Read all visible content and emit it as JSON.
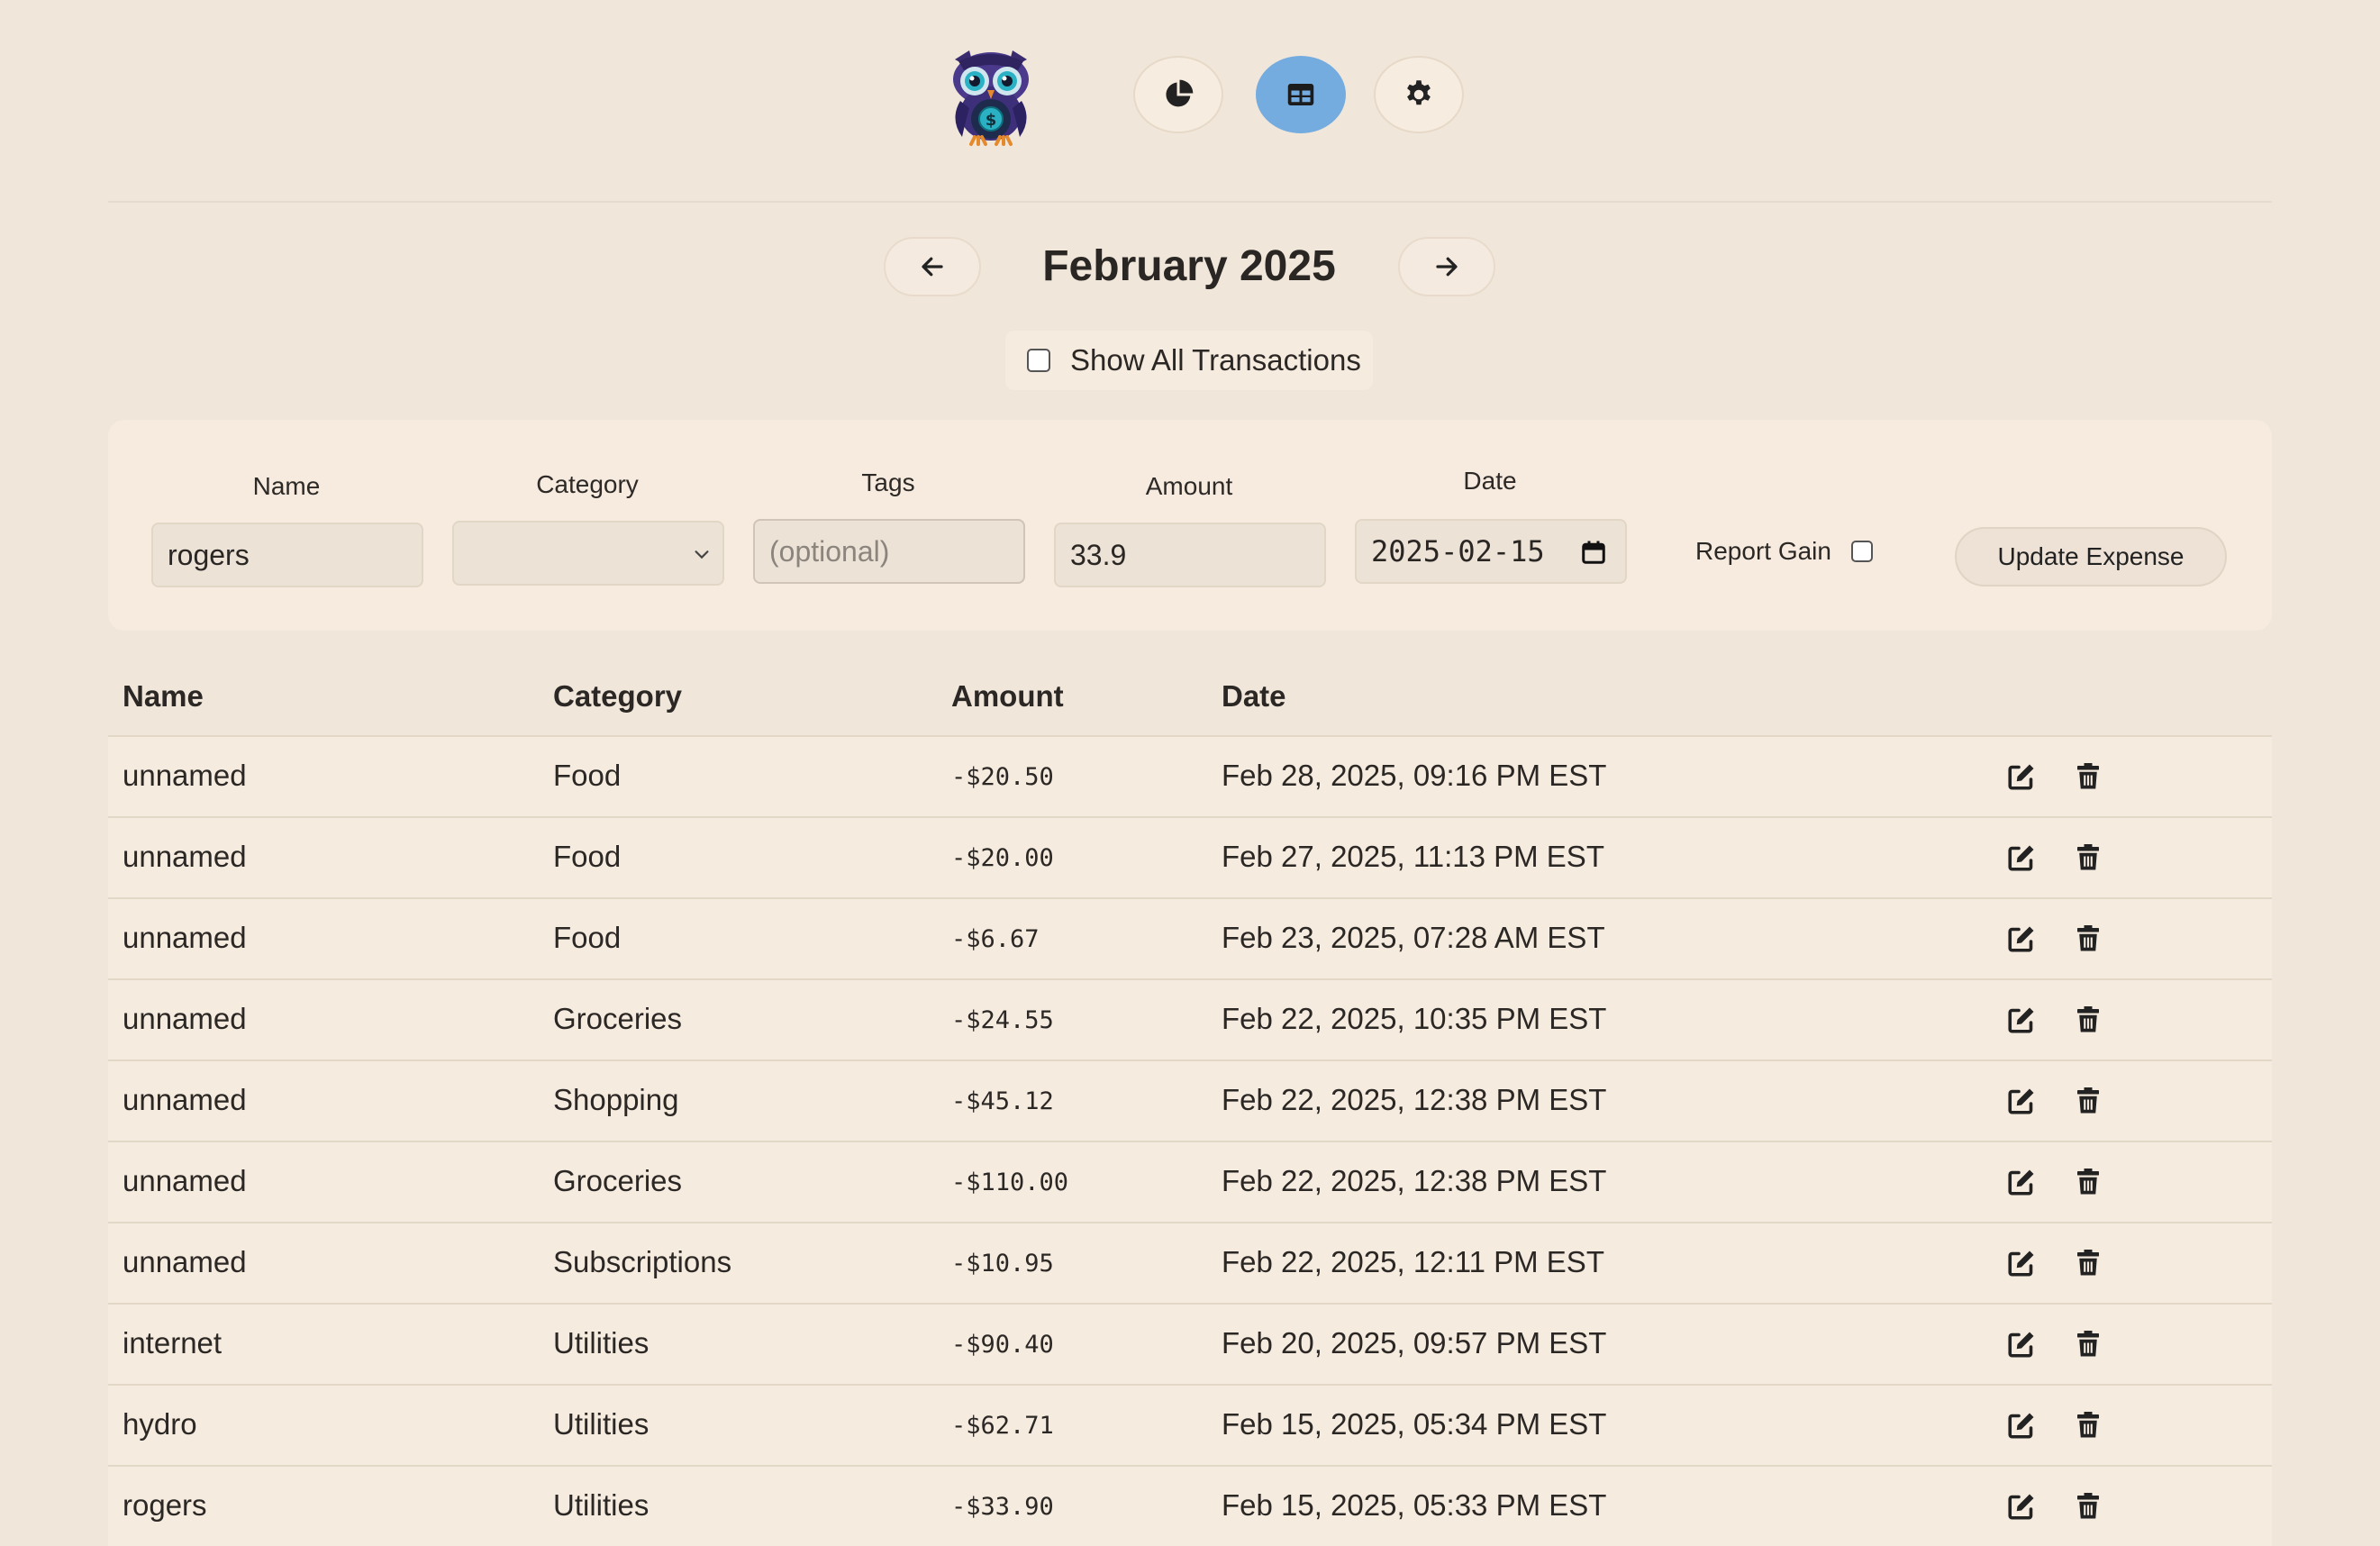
{
  "month_nav": {
    "title": "February 2025"
  },
  "filters": {
    "show_all_label": "Show All Transactions"
  },
  "form": {
    "name_label": "Name",
    "name_value": "rogers",
    "category_label": "Category",
    "category_value": "",
    "tags_label": "Tags",
    "tags_placeholder": "(optional)",
    "amount_label": "Amount",
    "amount_value": "33.9",
    "date_label": "Date",
    "date_value": "2025-02-15",
    "report_gain_label": "Report Gain",
    "update_label": "Update Expense"
  },
  "table": {
    "headers": {
      "name": "Name",
      "category": "Category",
      "amount": "Amount",
      "date": "Date"
    },
    "rows": [
      {
        "name": "unnamed",
        "category": "Food",
        "amount": "-$20.50",
        "date": "Feb 28, 2025, 09:16 PM EST"
      },
      {
        "name": "unnamed",
        "category": "Food",
        "amount": "-$20.00",
        "date": "Feb 27, 2025, 11:13 PM EST"
      },
      {
        "name": "unnamed",
        "category": "Food",
        "amount": "-$6.67",
        "date": "Feb 23, 2025, 07:28 AM EST"
      },
      {
        "name": "unnamed",
        "category": "Groceries",
        "amount": "-$24.55",
        "date": "Feb 22, 2025, 10:35 PM EST"
      },
      {
        "name": "unnamed",
        "category": "Shopping",
        "amount": "-$45.12",
        "date": "Feb 22, 2025, 12:38 PM EST"
      },
      {
        "name": "unnamed",
        "category": "Groceries",
        "amount": "-$110.00",
        "date": "Feb 22, 2025, 12:38 PM EST"
      },
      {
        "name": "unnamed",
        "category": "Subscriptions",
        "amount": "-$10.95",
        "date": "Feb 22, 2025, 12:11 PM EST"
      },
      {
        "name": "internet",
        "category": "Utilities",
        "amount": "-$90.40",
        "date": "Feb 20, 2025, 09:57 PM EST"
      },
      {
        "name": "hydro",
        "category": "Utilities",
        "amount": "-$62.71",
        "date": "Feb 15, 2025, 05:34 PM EST"
      },
      {
        "name": "rogers",
        "category": "Utilities",
        "amount": "-$33.90",
        "date": "Feb 15, 2025, 05:33 PM EST"
      }
    ]
  },
  "icons": {
    "logo": "owl-logo-icon",
    "dashboard": "pie-chart-icon",
    "transactions": "table-icon",
    "settings": "gear-icon",
    "prev": "arrow-left-icon",
    "next": "arrow-right-icon",
    "edit": "edit-icon",
    "delete": "trash-icon"
  },
  "colors": {
    "background": "#f0e6da",
    "panel": "#f7ebdf",
    "active_nav": "#75ace0",
    "text": "#2b2724"
  }
}
